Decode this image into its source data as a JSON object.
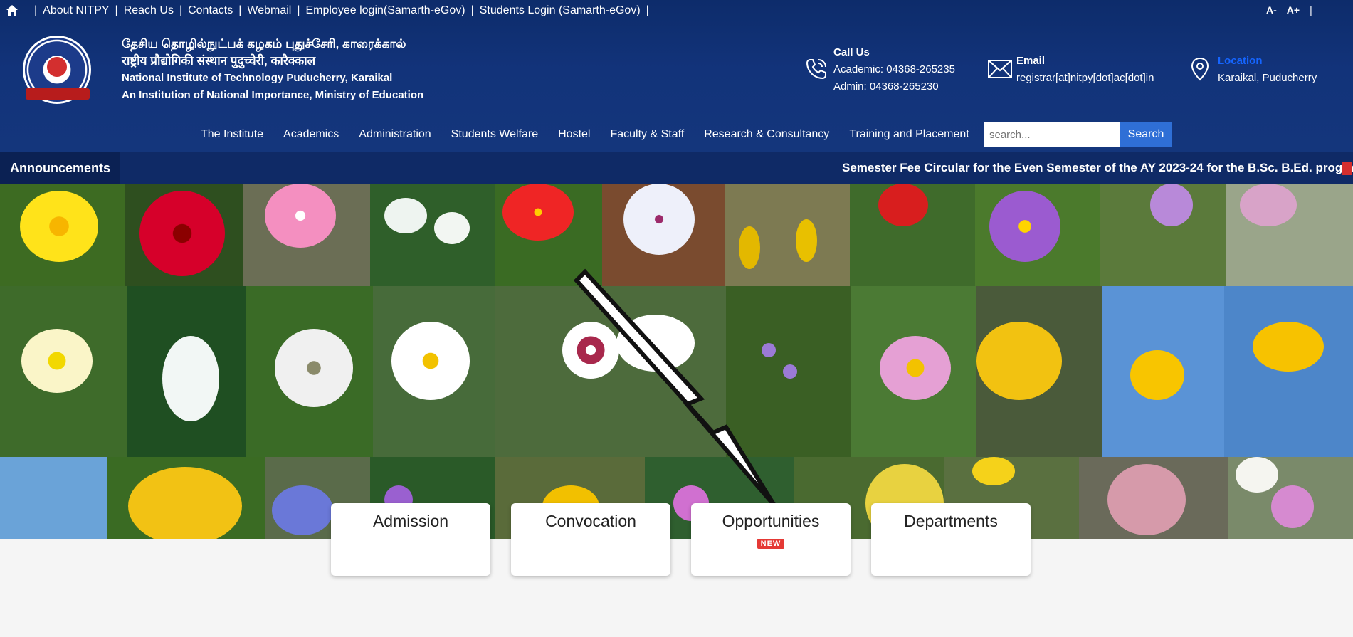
{
  "topbar": {
    "links": [
      "About NITPY",
      "Reach Us",
      "Contacts",
      "Webmail",
      "Employee login(Samarth-eGov)",
      "Students Login (Samarth-eGov)"
    ],
    "font_decrease": "A-",
    "font_increase": "A+"
  },
  "institute": {
    "name_tamil": "தேசிய தொழில்நுட்பக் கழகம் புதுச்சேரி, காரைக்கால்",
    "name_hindi": "राष्ट्रीय प्रौद्योगिकी संस्थान पुदुच्चेरी, कारैक्काल",
    "name_english": "National Institute of Technology Puducherry, Karaikal",
    "tagline": "An Institution of National Importance, Ministry of Education"
  },
  "contact": {
    "call_title": "Call Us",
    "academic": "Academic: 04368-265235",
    "admin": "Admin: 04368-265230",
    "email_title": "Email",
    "email": "registrar[at]nitpy[dot]ac[dot]in",
    "location_title": "Location",
    "location": "Karaikal, Puducherry"
  },
  "nav": {
    "items": [
      "The Institute",
      "Academics",
      "Administration",
      "Students Welfare",
      "Hostel",
      "Faculty & Staff",
      "Research & Consultancy",
      "Training and Placement"
    ],
    "search_placeholder": "search...",
    "search_label": "Search"
  },
  "announcements": {
    "label": "Announcements",
    "text": "Semester Fee Circular for the Even Semester of the AY 2023-24 for the B.Sc. B.Ed. programme"
  },
  "cards": [
    {
      "label": "Admission"
    },
    {
      "label": "Convocation"
    },
    {
      "label": "Opportunities",
      "badge": "NEW"
    },
    {
      "label": "Departments"
    }
  ],
  "colors": {
    "header_bg": "#12337a",
    "announce_bg": "#0f2a66",
    "search_button": "#2f6fd6",
    "new_badge": "#e53935",
    "location_accent": "#1565ff"
  }
}
